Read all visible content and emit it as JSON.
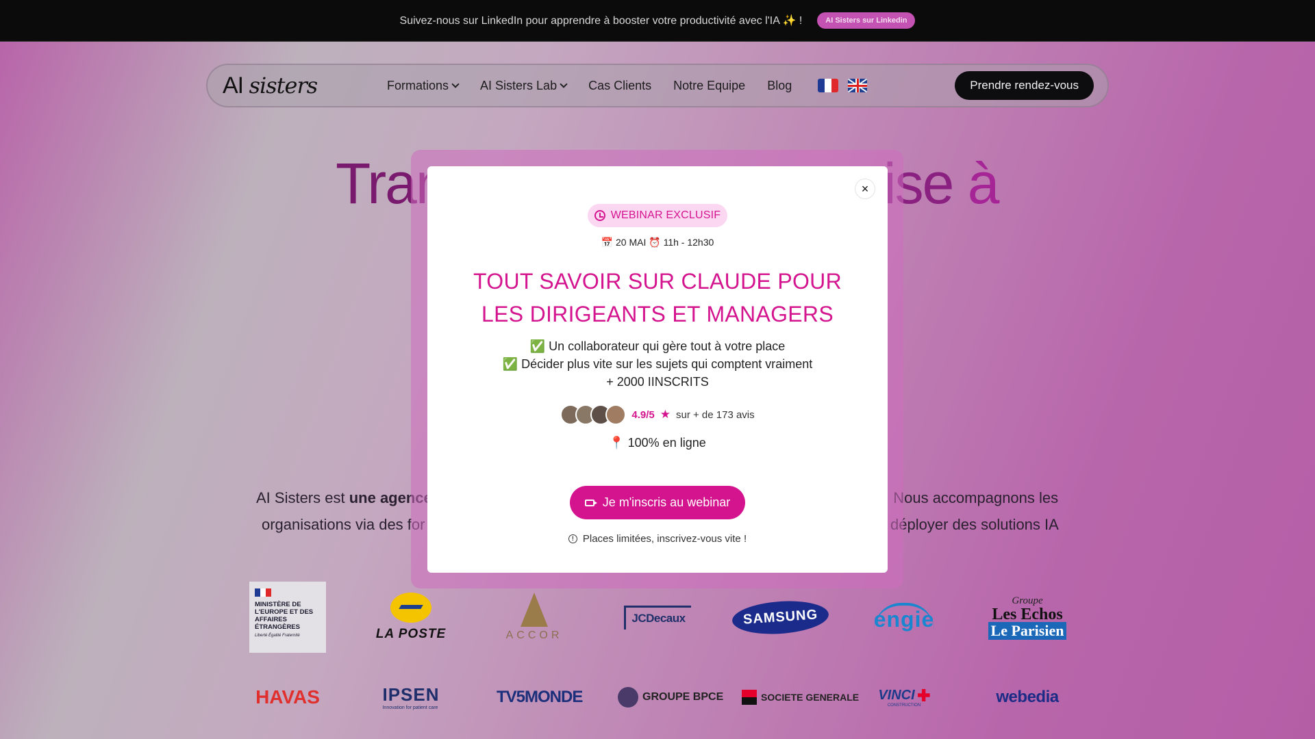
{
  "topbar": {
    "text": "Suivez-nous sur LinkedIn pour apprendre à booster votre productivité avec l'IA ✨ !",
    "button": "AI Sisters sur Linkedin"
  },
  "nav": {
    "logo_a": "AI",
    "logo_b": "sisters",
    "items": [
      "Formations",
      "AI Sisters Lab",
      "Cas Clients",
      "Notre Equipe",
      "Blog"
    ],
    "cta": "Prendre rendez-vous",
    "flags": [
      "flag-fr-icon",
      "flag-uk-icon"
    ]
  },
  "hero": {
    "title_start": "Tran",
    "title_end_a": "ise ",
    "title_end_b": "à"
  },
  "intro": {
    "line1_a": "AI Sisters est ",
    "line1_b": "une agence",
    "line1_c": ". Nous accompagnons les",
    "line2_a": "organisations via des for",
    "line2_b": "déployer des solutions IA"
  },
  "clients_row1": [
    "MINISTÈRE DE L'EUROPE ET DES AFFAIRES ÉTRANGÈRES",
    "LA POSTE",
    "ACCOR",
    "JCDecaux",
    "SAMSUNG",
    "ENGIE",
    "Groupe Les Echos Le Parisien"
  ],
  "clients_row1_mini": "Liberté Égalité Fraternité",
  "clients_row2": [
    "HAVAS",
    "IPSEN",
    "TV5MONDE",
    "GROUPE BPCE",
    "SOCIETE GENERALE",
    "VINCI",
    "webedia"
  ],
  "client_taglines": {
    "ipsen": "Innovation for patient care",
    "vinci": "CONSTRUCTION",
    "echos_groupe": "Groupe",
    "echos_a": "Les Echos",
    "echos_b": "Le Parisien"
  },
  "modal": {
    "badge": "WEBINAR EXCLUSIF",
    "date": "📅 20 MAI ⏰ 11h - 12h30",
    "title": "TOUT SAVOIR SUR CLAUDE POUR LES DIRIGEANTS ET MANAGERS",
    "bullet1": "✅ Un collaborateur qui gère tout à votre place",
    "bullet2": "✅ Décider plus vite sur les sujets qui comptent vraiment",
    "bullet3": "+ 2000 IINSCRITS",
    "score": "4.9/5",
    "star": "★",
    "reviews": "sur + de 173 avis",
    "online": "📍 100% en ligne",
    "button": "Je m'inscris au webinar",
    "note": "Places limitées, inscrivez-vous vite !",
    "close": "×"
  },
  "colors": {
    "accent": "#d4148f",
    "badge_bg": "#fbd7f2",
    "topbar_bg": "#0b0b0c"
  }
}
